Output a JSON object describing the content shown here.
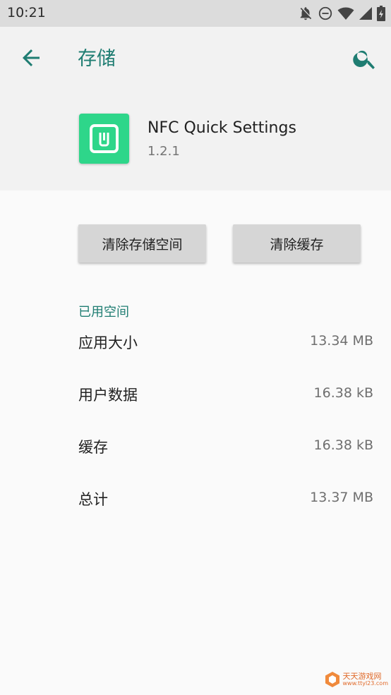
{
  "status_bar": {
    "time": "10:21"
  },
  "header": {
    "title": "存储"
  },
  "app": {
    "name": "NFC Quick Settings",
    "version": "1.2.1",
    "icon_color": "#2ed68a"
  },
  "actions": {
    "clear_storage": "清除存储空间",
    "clear_cache": "清除缓存"
  },
  "storage": {
    "section_title": "已用空间",
    "rows": [
      {
        "label": "应用大小",
        "value": "13.34 MB"
      },
      {
        "label": "用户数据",
        "value": "16.38 kB"
      },
      {
        "label": "缓存",
        "value": "16.38 kB"
      },
      {
        "label": "总计",
        "value": "13.37 MB"
      }
    ]
  },
  "watermark": {
    "text": "天天游戏网",
    "sub": "www.ttyl23.com"
  },
  "colors": {
    "accent": "#1f7d72",
    "header_bg": "#f2f2f2",
    "button_bg": "#d6d6d6"
  }
}
